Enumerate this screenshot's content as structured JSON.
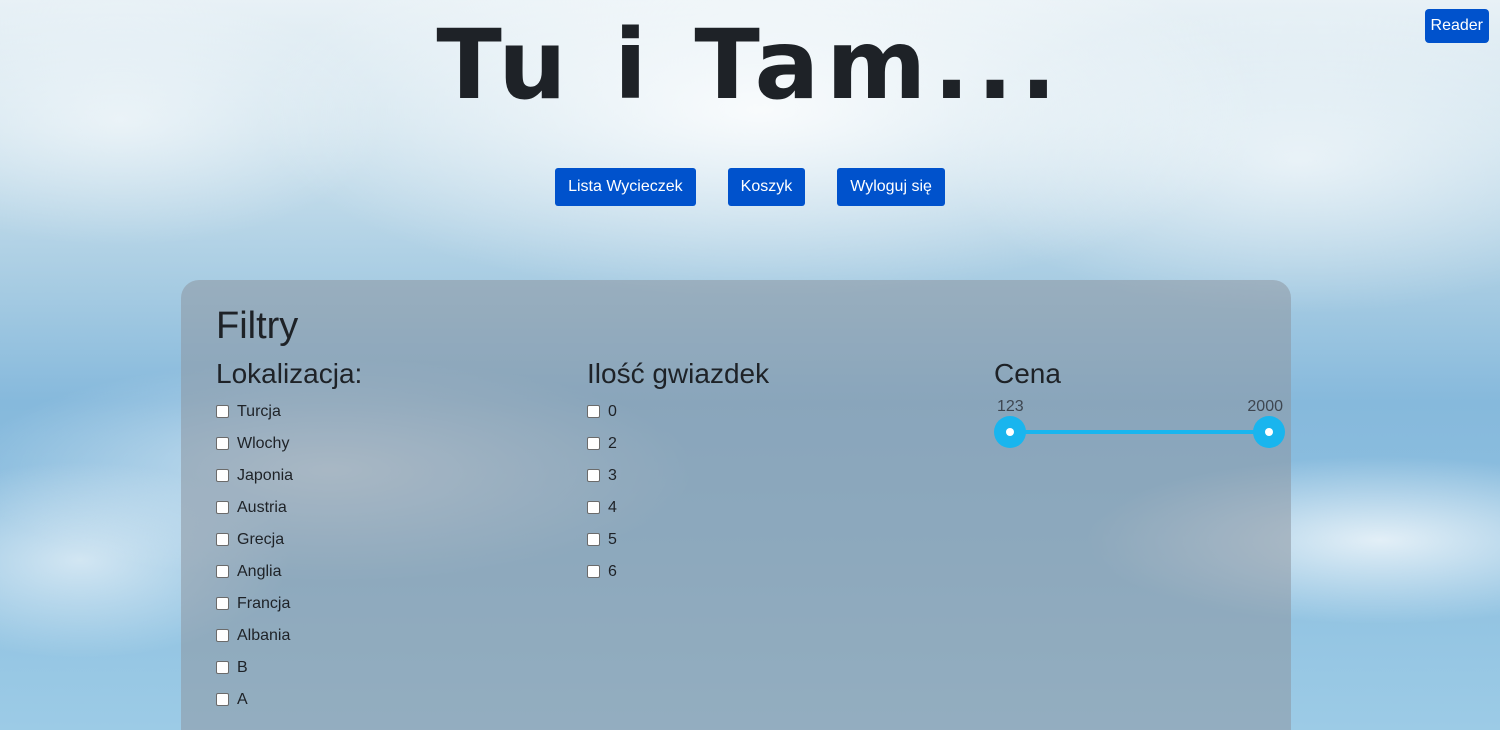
{
  "header": {
    "title": "Tu i Tam...",
    "reader_button": "Reader"
  },
  "nav": {
    "items": [
      {
        "label": "Lista Wycieczek"
      },
      {
        "label": "Koszyk"
      },
      {
        "label": "Wyloguj się"
      }
    ]
  },
  "filters": {
    "title": "Filtry",
    "location": {
      "heading": "Lokalizacja:",
      "options": [
        "Turcja",
        "Wlochy",
        "Japonia",
        "Austria",
        "Grecja",
        "Anglia",
        "Francja",
        "Albania",
        "B",
        "A"
      ]
    },
    "stars": {
      "heading": "Ilość gwiazdek",
      "options": [
        "0",
        "2",
        "3",
        "4",
        "5",
        "6"
      ]
    },
    "price": {
      "heading": "Cena",
      "min_label": "123",
      "max_label": "2000"
    }
  },
  "colors": {
    "button": "#0052cc",
    "slider_accent": "#19b5ee"
  }
}
